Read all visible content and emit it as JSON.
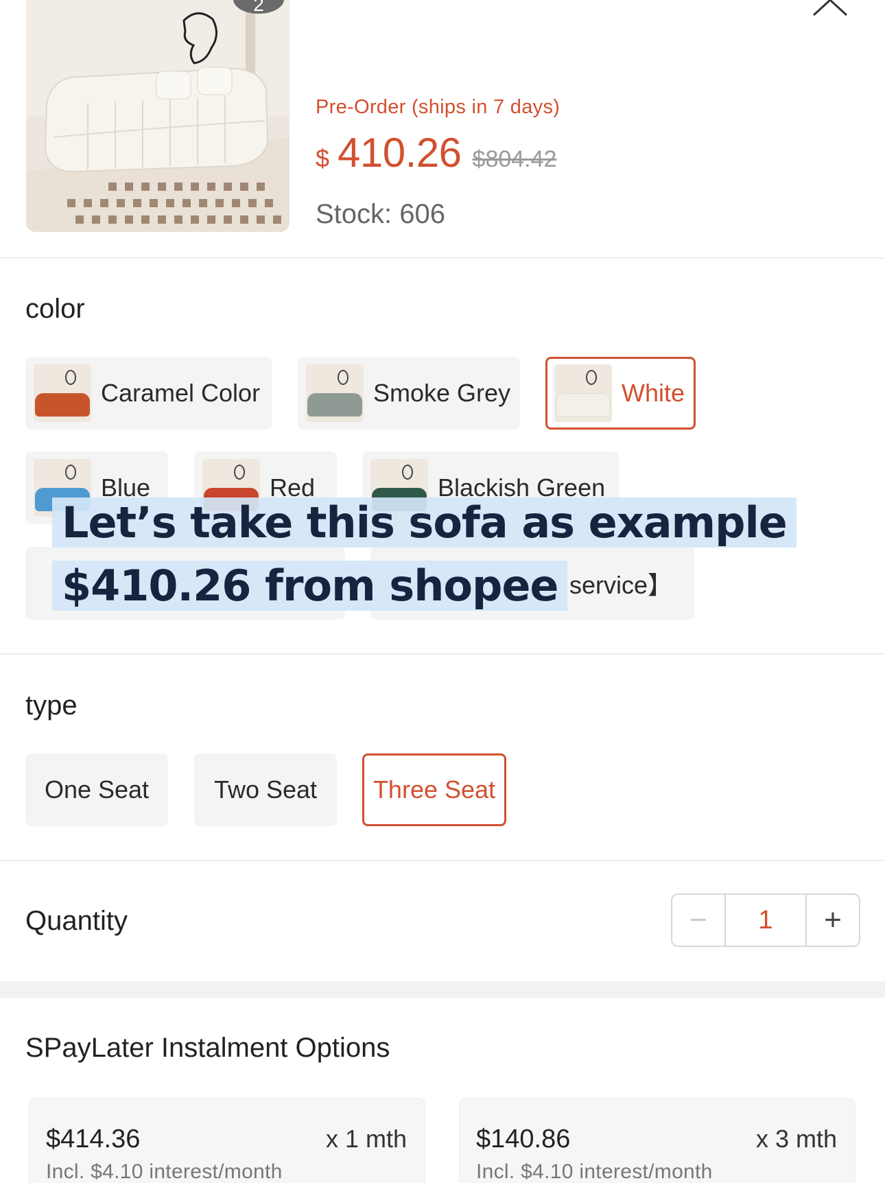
{
  "header": {
    "preorder": "Pre-Order (ships in 7 days)",
    "currency": "$",
    "price": "410.26",
    "old_price": "$804.42",
    "stock": "Stock: 606",
    "badge": "2"
  },
  "color": {
    "title": "color",
    "options": [
      {
        "label": "Caramel Color",
        "selected": false
      },
      {
        "label": "Smoke Grey",
        "selected": false
      },
      {
        "label": "White",
        "selected": true
      },
      {
        "label": "Blue",
        "selected": false
      },
      {
        "label": "Red",
        "selected": false
      },
      {
        "label": "Blackish Green",
        "selected": false
      },
      {
        "label": "service】",
        "selected": false
      }
    ]
  },
  "overlay": {
    "line1": "Let’s take this sofa as example",
    "line2": "$410.26 from shopee"
  },
  "type": {
    "title": "type",
    "options": [
      {
        "label": "One Seat",
        "selected": false
      },
      {
        "label": "Two Seat",
        "selected": false
      },
      {
        "label": "Three Seat",
        "selected": true
      }
    ]
  },
  "quantity": {
    "title": "Quantity",
    "value": "1",
    "minus": "−",
    "plus": "+"
  },
  "instalment": {
    "title": "SPayLater Instalment Options",
    "plans": [
      {
        "amount": "$414.36",
        "months": "x 1 mth",
        "interest": "Incl. $4.10 interest/month"
      },
      {
        "amount": "$140.86",
        "months": "x 3 mth",
        "interest": "Incl. $4.10 interest/month"
      }
    ]
  },
  "colors": {
    "accent": "#d2502f",
    "chip_bg": "#f4f4f4",
    "caption_bg": "#d2e6f6",
    "caption_text": "#17233f"
  }
}
